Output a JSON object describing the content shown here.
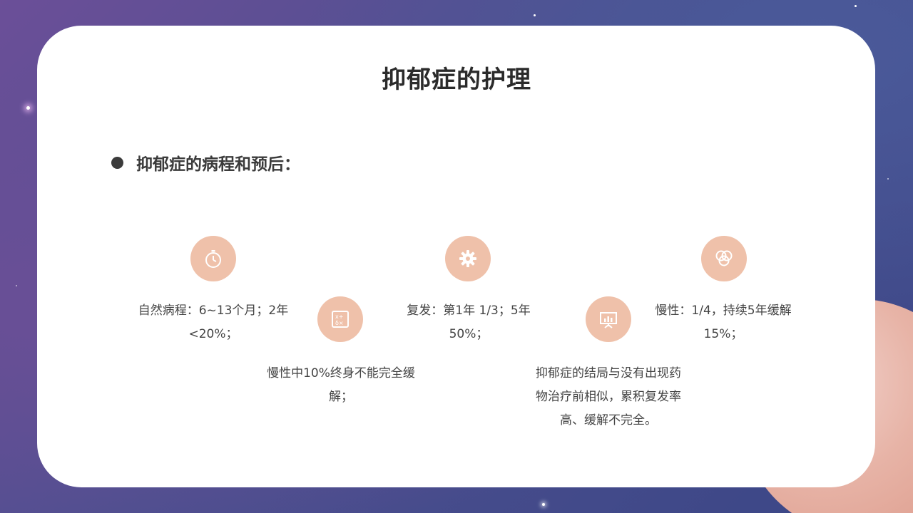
{
  "slide": {
    "title": "抑郁症的护理",
    "bullet": "抑郁症的病程和预后："
  },
  "items": [
    {
      "icon": "stopwatch-icon",
      "text": "自然病程：6~13个月；2年<20%；"
    },
    {
      "icon": "formula-icon",
      "text": "慢性中10%终身不能完全缓解；"
    },
    {
      "icon": "gear-icon",
      "text": "复发：第1年 1/3；5年50%；"
    },
    {
      "icon": "presentation-chart-icon",
      "text": "抑郁症的结局与没有出现药物治疗前相似，累积复发率高、缓解不完全。"
    },
    {
      "icon": "overlap-circles-icon",
      "text": "慢性：1/4，持续5年缓解15%；"
    }
  ],
  "colors": {
    "icon_bg": "#efc1aa",
    "title": "#2b2b2b",
    "body_text": "#444444"
  }
}
